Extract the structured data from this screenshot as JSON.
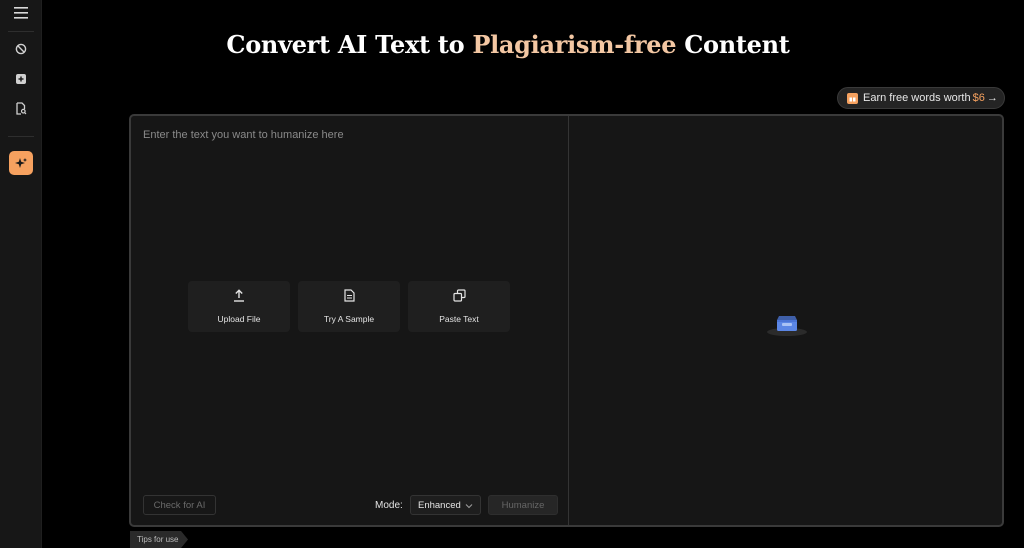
{
  "sidebar": {
    "icons": [
      "menu-icon",
      "ban-icon",
      "plus-square-icon",
      "doc-search-icon",
      "sparkle-icon"
    ]
  },
  "header": {
    "title_part1": "Convert AI Text to",
    "title_highlight": "Plagiarism-free",
    "title_part2": "Content"
  },
  "earn": {
    "label": "Earn free words worth",
    "amount": "$6",
    "arrow": "→"
  },
  "editor": {
    "placeholder": "Enter the text you want to humanize here",
    "actions": [
      {
        "label": "Upload File",
        "icon": "upload-icon"
      },
      {
        "label": "Try A Sample",
        "icon": "document-icon"
      },
      {
        "label": "Paste Text",
        "icon": "copy-icon"
      }
    ],
    "check_label": "Check for AI",
    "mode_label": "Mode:",
    "mode_value": "Enhanced",
    "humanize_label": "Humanize"
  },
  "tips": {
    "label": "Tips for use"
  },
  "colors": {
    "accent": "#f6a15f",
    "highlight": "#f3c7a3",
    "background": "#000000"
  }
}
